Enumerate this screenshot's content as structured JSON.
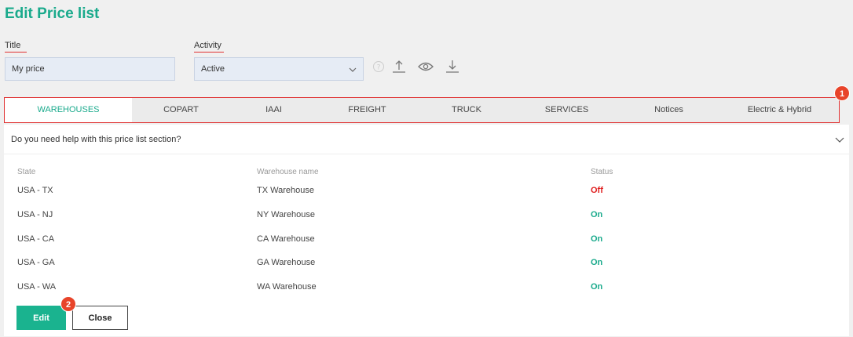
{
  "header": {
    "title": "Edit Price list"
  },
  "form": {
    "title_label": "Title",
    "title_value": "My price",
    "activity_label": "Activity",
    "activity_value": "Active"
  },
  "toolbar": {
    "icons": [
      "help-icon",
      "upload-icon",
      "eye-icon",
      "download-icon"
    ]
  },
  "tabs": [
    {
      "label": "WAREHOUSES",
      "active": true
    },
    {
      "label": "COPART"
    },
    {
      "label": "IAAI"
    },
    {
      "label": "FREIGHT"
    },
    {
      "label": "TRUCK"
    },
    {
      "label": "SERVICES"
    },
    {
      "label": "Notices"
    },
    {
      "label": "Electric & Hybrid"
    }
  ],
  "annotations": {
    "tabs_badge": "1",
    "edit_badge": "2"
  },
  "help": {
    "text": "Do you need help with this price list section?"
  },
  "table": {
    "headers": {
      "state": "State",
      "warehouse": "Warehouse name",
      "status": "Status"
    },
    "rows": [
      {
        "state": "USA - TX",
        "warehouse": "TX Warehouse",
        "status": "Off"
      },
      {
        "state": "USA - NJ",
        "warehouse": "NY Warehouse",
        "status": "On"
      },
      {
        "state": "USA - CA",
        "warehouse": "CA Warehouse",
        "status": "On"
      },
      {
        "state": "USA - GA",
        "warehouse": "GA Warehouse",
        "status": "On"
      },
      {
        "state": "USA - WA",
        "warehouse": "WA Warehouse",
        "status": "On"
      }
    ]
  },
  "buttons": {
    "edit": "Edit",
    "close": "Close"
  },
  "colors": {
    "accent": "#1aaa8c",
    "on": "#1aaa8c",
    "off": "#e02020",
    "badge": "#e8442a",
    "highlight": "#e03030"
  }
}
